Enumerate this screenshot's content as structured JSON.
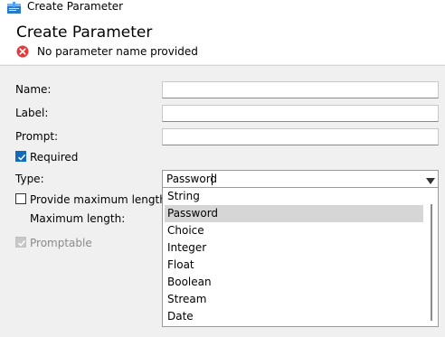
{
  "window": {
    "title": "Create Parameter"
  },
  "header": {
    "title": "Create Parameter",
    "error_message": "No parameter name provided"
  },
  "form": {
    "name_label": "Name:",
    "label_label": "Label:",
    "prompt_label": "Prompt:",
    "required_label": "Required",
    "required_checked": true,
    "type_label": "Type:",
    "type_value": "Password",
    "provide_max_label": "Provide maximum length",
    "provide_max_checked": false,
    "max_length_label": "Maximum length:",
    "promptable_label": "Promptable",
    "promptable_checked": true,
    "promptable_enabled": false
  },
  "dropdown": {
    "options": [
      "String",
      "Password",
      "Choice",
      "Integer",
      "Float",
      "Boolean",
      "Stream",
      "Date"
    ],
    "selected": "Password"
  },
  "colors": {
    "accent": "#0f6cbd",
    "error": "#e03b3b",
    "selection": "#d6d6d6"
  },
  "icons": {
    "app": "create-parameter-icon",
    "error": "error-icon",
    "dropdown": "dropdown-arrow-icon"
  }
}
